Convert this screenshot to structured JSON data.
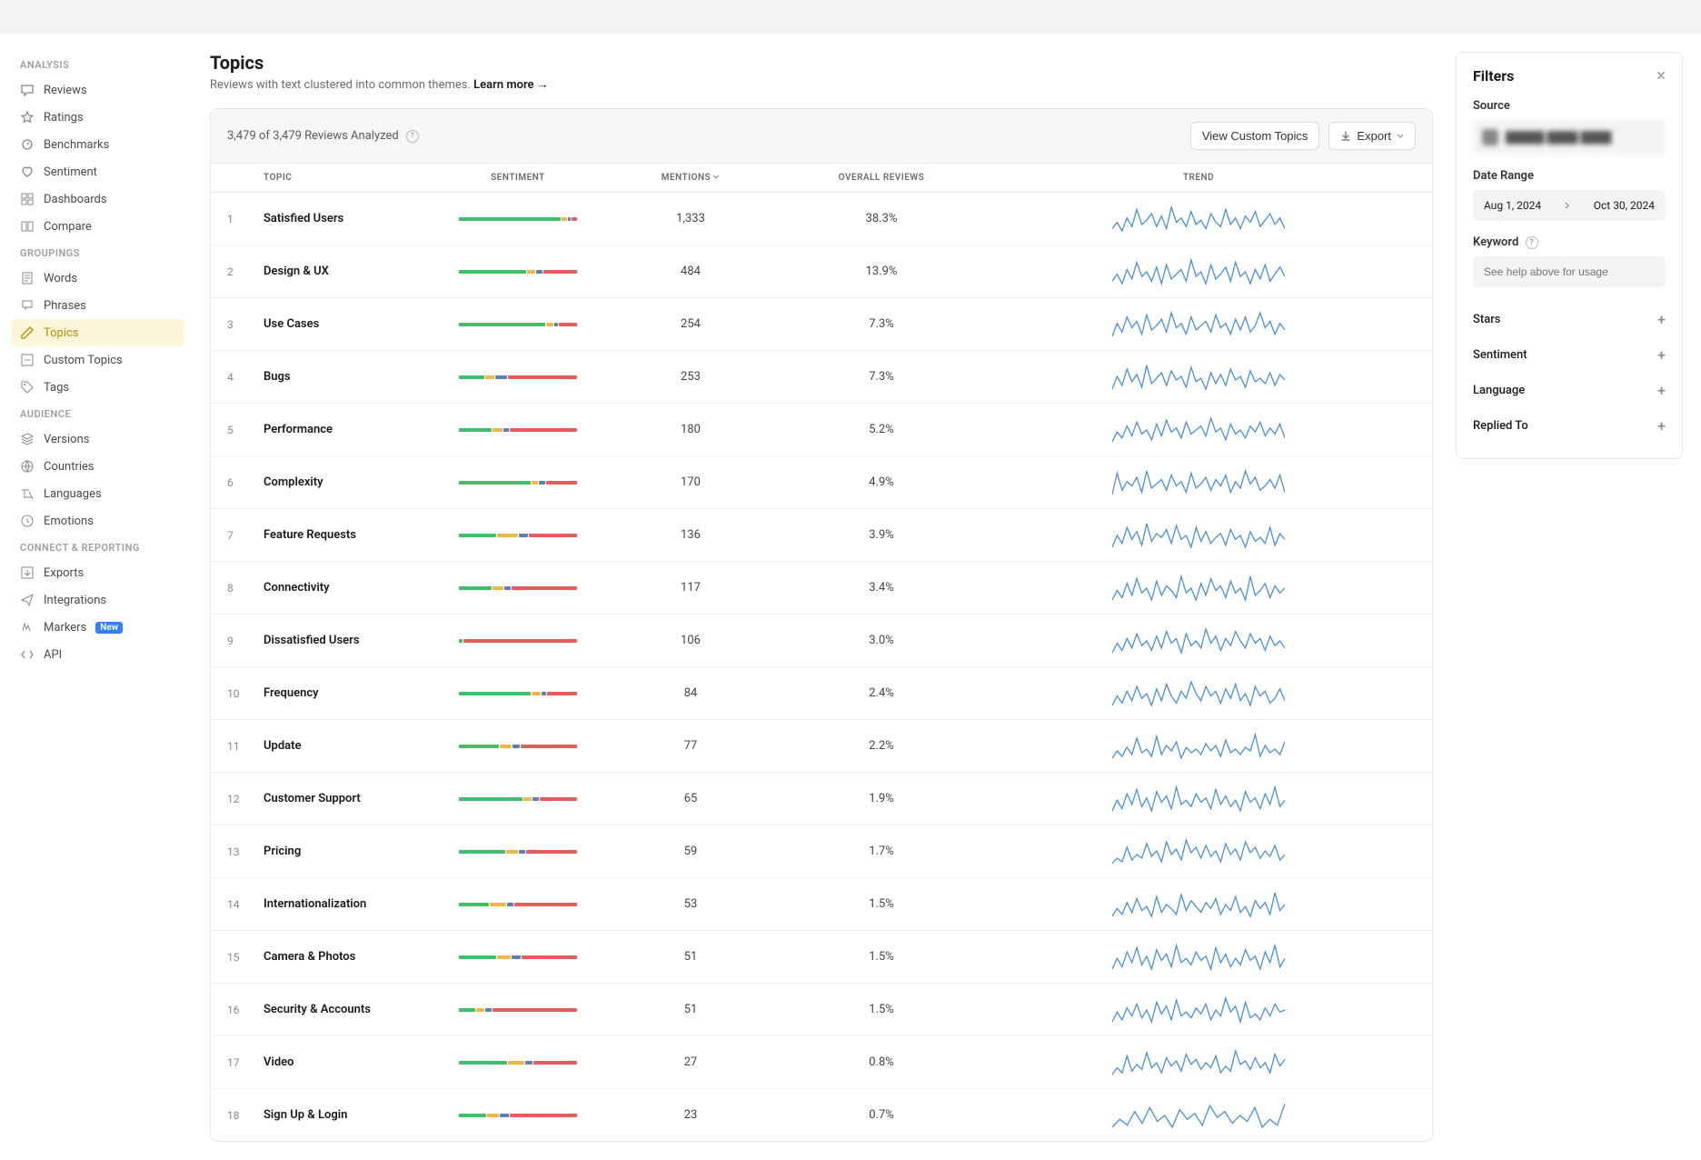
{
  "sidebar": {
    "sections": [
      {
        "heading": "ANALYSIS",
        "items": [
          {
            "label": "Reviews",
            "icon": "chat"
          },
          {
            "label": "Ratings",
            "icon": "star"
          },
          {
            "label": "Benchmarks",
            "icon": "speed"
          },
          {
            "label": "Sentiment",
            "icon": "heart"
          },
          {
            "label": "Dashboards",
            "icon": "grid"
          },
          {
            "label": "Compare",
            "icon": "compare"
          }
        ]
      },
      {
        "heading": "GROUPINGS",
        "items": [
          {
            "label": "Words",
            "icon": "doc"
          },
          {
            "label": "Phrases",
            "icon": "bubble"
          },
          {
            "label": "Topics",
            "icon": "pencil",
            "active": true
          },
          {
            "label": "Custom Topics",
            "icon": "edit"
          },
          {
            "label": "Tags",
            "icon": "tag"
          }
        ]
      },
      {
        "heading": "AUDIENCE",
        "items": [
          {
            "label": "Versions",
            "icon": "layers"
          },
          {
            "label": "Countries",
            "icon": "globe"
          },
          {
            "label": "Languages",
            "icon": "lang"
          },
          {
            "label": "Emotions",
            "icon": "clock"
          }
        ]
      },
      {
        "heading": "CONNECT & REPORTING",
        "items": [
          {
            "label": "Exports",
            "icon": "export"
          },
          {
            "label": "Integrations",
            "icon": "send"
          },
          {
            "label": "Markers",
            "icon": "marker",
            "badge": "New"
          },
          {
            "label": "API",
            "icon": "code"
          }
        ]
      }
    ]
  },
  "page": {
    "title": "Topics",
    "subtitle": "Reviews with text clustered into common themes.",
    "learn_more": "Learn more →"
  },
  "table": {
    "status": "3,479 of 3,479 Reviews Analyzed",
    "btn_custom": "View Custom Topics",
    "btn_export": "Export",
    "cols": {
      "topic": "TOPIC",
      "sentiment": "SENTIMENT",
      "mentions": "MENTIONS",
      "reviews": "OVERALL REVIEWS",
      "trend": "TREND"
    }
  },
  "chart_data": {
    "type": "table",
    "note": "Sentiment = stacked percentage bar [positive, warn, neutral, negative]. Trend = sparkline points.",
    "rows": [
      {
        "n": 1,
        "topic": "Satisfied Users",
        "mentions": "1,333",
        "reviews": "38.3%",
        "sent": [
          88,
          5,
          2,
          5
        ],
        "trend": [
          5,
          8,
          4,
          10,
          6,
          14,
          7,
          9,
          12,
          6,
          11,
          5,
          15,
          8,
          10,
          6,
          13,
          7,
          9,
          5,
          12,
          8,
          6,
          14,
          7,
          10,
          5,
          11,
          8,
          13,
          6,
          9,
          12,
          7,
          10,
          5
        ]
      },
      {
        "n": 2,
        "topic": "Design & UX",
        "mentions": "484",
        "reviews": "13.9%",
        "sent": [
          58,
          7,
          6,
          29
        ],
        "trend": [
          6,
          9,
          5,
          11,
          7,
          14,
          8,
          10,
          6,
          12,
          5,
          13,
          7,
          9,
          11,
          6,
          15,
          8,
          10,
          5,
          13,
          7,
          9,
          12,
          6,
          14,
          8,
          10,
          5,
          11,
          7,
          13,
          6,
          9,
          12,
          8
        ]
      },
      {
        "n": 3,
        "topic": "Use Cases",
        "mentions": "254",
        "reviews": "7.3%",
        "sent": [
          75,
          6,
          3,
          16
        ],
        "trend": [
          4,
          10,
          6,
          13,
          8,
          11,
          5,
          14,
          7,
          9,
          12,
          6,
          15,
          8,
          10,
          5,
          13,
          7,
          9,
          11,
          6,
          14,
          8,
          10,
          5,
          12,
          7,
          13,
          6,
          9,
          15,
          8,
          11,
          5,
          10,
          7
        ]
      },
      {
        "n": 4,
        "topic": "Bugs",
        "mentions": "253",
        "reviews": "7.3%",
        "sent": [
          22,
          8,
          10,
          60
        ],
        "trend": [
          5,
          12,
          7,
          16,
          9,
          13,
          6,
          18,
          8,
          11,
          14,
          7,
          15,
          10,
          12,
          6,
          17,
          9,
          11,
          5,
          14,
          8,
          13,
          7,
          16,
          10,
          12,
          6,
          15,
          9,
          11,
          8,
          14,
          7,
          13,
          10
        ]
      },
      {
        "n": 5,
        "topic": "Performance",
        "mentions": "180",
        "reviews": "5.2%",
        "sent": [
          28,
          9,
          5,
          58
        ],
        "trend": [
          3,
          8,
          5,
          11,
          6,
          13,
          7,
          9,
          4,
          12,
          6,
          14,
          8,
          10,
          5,
          13,
          7,
          9,
          11,
          6,
          15,
          8,
          10,
          4,
          12,
          7,
          9,
          5,
          11,
          8,
          13,
          6,
          10,
          7,
          12,
          5
        ]
      },
      {
        "n": 6,
        "topic": "Complexity",
        "mentions": "170",
        "reviews": "4.9%",
        "sent": [
          62,
          6,
          5,
          27
        ],
        "trend": [
          4,
          14,
          6,
          10,
          8,
          12,
          5,
          15,
          7,
          9,
          11,
          6,
          13,
          8,
          10,
          5,
          14,
          7,
          9,
          12,
          6,
          11,
          8,
          13,
          5,
          10,
          7,
          15,
          9,
          12,
          6,
          8,
          11,
          7,
          13,
          5
        ]
      },
      {
        "n": 7,
        "topic": "Feature Requests",
        "mentions": "136",
        "reviews": "3.9%",
        "sent": [
          32,
          18,
          8,
          42
        ],
        "trend": [
          6,
          12,
          8,
          16,
          10,
          14,
          7,
          18,
          9,
          13,
          11,
          15,
          8,
          17,
          10,
          12,
          6,
          16,
          9,
          14,
          8,
          11,
          13,
          7,
          15,
          10,
          12,
          6,
          14,
          9,
          11,
          8,
          16,
          7,
          13,
          10
        ]
      },
      {
        "n": 8,
        "topic": "Connectivity",
        "mentions": "117",
        "reviews": "3.4%",
        "sent": [
          28,
          10,
          5,
          57
        ],
        "trend": [
          5,
          9,
          6,
          12,
          7,
          14,
          8,
          10,
          5,
          13,
          7,
          11,
          9,
          6,
          15,
          8,
          10,
          5,
          12,
          7,
          14,
          9,
          11,
          6,
          13,
          8,
          10,
          5,
          15,
          7,
          9,
          12,
          6,
          11,
          8,
          10
        ]
      },
      {
        "n": 9,
        "topic": "Dissatisfied Users",
        "mentions": "106",
        "reviews": "3.0%",
        "sent": [
          3,
          0,
          0,
          97
        ],
        "trend": [
          3,
          7,
          4,
          9,
          5,
          11,
          6,
          8,
          4,
          10,
          5,
          12,
          7,
          9,
          3,
          11,
          6,
          8,
          5,
          13,
          7,
          10,
          4,
          9,
          6,
          12,
          8,
          5,
          11,
          7,
          9,
          4,
          10,
          6,
          8,
          5
        ]
      },
      {
        "n": 10,
        "topic": "Frequency",
        "mentions": "84",
        "reviews": "2.4%",
        "sent": [
          62,
          8,
          4,
          26
        ],
        "trend": [
          4,
          8,
          5,
          10,
          6,
          12,
          7,
          9,
          4,
          11,
          6,
          13,
          8,
          5,
          10,
          7,
          14,
          9,
          6,
          12,
          8,
          10,
          5,
          11,
          7,
          13,
          6,
          9,
          4,
          12,
          8,
          10,
          5,
          7,
          11,
          6
        ]
      },
      {
        "n": 11,
        "topic": "Update",
        "mentions": "77",
        "reviews": "2.2%",
        "sent": [
          35,
          10,
          6,
          49
        ],
        "trend": [
          3,
          7,
          4,
          9,
          5,
          14,
          6,
          8,
          4,
          15,
          5,
          10,
          7,
          12,
          3,
          9,
          6,
          8,
          5,
          11,
          7,
          10,
          4,
          13,
          6,
          8,
          5,
          9,
          7,
          16,
          4,
          10,
          6,
          8,
          5,
          12
        ]
      },
      {
        "n": 12,
        "topic": "Customer Support",
        "mentions": "65",
        "reviews": "1.9%",
        "sent": [
          55,
          7,
          6,
          32
        ],
        "trend": [
          4,
          9,
          5,
          12,
          7,
          14,
          6,
          10,
          4,
          13,
          8,
          11,
          5,
          15,
          7,
          9,
          6,
          12,
          8,
          10,
          5,
          14,
          7,
          11,
          6,
          9,
          4,
          13,
          8,
          10,
          5,
          12,
          7,
          15,
          6,
          9
        ]
      },
      {
        "n": 13,
        "topic": "Pricing",
        "mentions": "59",
        "reviews": "1.7%",
        "sent": [
          40,
          10,
          6,
          44
        ],
        "trend": [
          3,
          6,
          4,
          12,
          5,
          8,
          6,
          14,
          7,
          10,
          4,
          15,
          8,
          11,
          5,
          16,
          9,
          12,
          6,
          13,
          7,
          10,
          4,
          14,
          8,
          11,
          5,
          15,
          9,
          12,
          6,
          10,
          7,
          13,
          5,
          8
        ]
      },
      {
        "n": 14,
        "topic": "Internationalization",
        "mentions": "53",
        "reviews": "1.5%",
        "sent": [
          26,
          14,
          6,
          54
        ],
        "trend": [
          4,
          8,
          5,
          11,
          6,
          13,
          7,
          9,
          4,
          14,
          6,
          10,
          8,
          5,
          15,
          7,
          12,
          9,
          6,
          11,
          8,
          13,
          5,
          10,
          7,
          14,
          6,
          9,
          4,
          12,
          8,
          11,
          5,
          16,
          7,
          10
        ]
      },
      {
        "n": 15,
        "topic": "Camera & Photos",
        "mentions": "51",
        "reviews": "1.5%",
        "sent": [
          32,
          12,
          8,
          48
        ],
        "trend": [
          5,
          10,
          6,
          13,
          8,
          15,
          7,
          11,
          5,
          14,
          9,
          12,
          6,
          16,
          8,
          10,
          7,
          13,
          9,
          11,
          5,
          15,
          8,
          12,
          6,
          10,
          7,
          14,
          9,
          11,
          5,
          13,
          8,
          16,
          6,
          10
        ]
      },
      {
        "n": 16,
        "topic": "Security & Accounts",
        "mentions": "51",
        "reviews": "1.5%",
        "sent": [
          14,
          7,
          6,
          73
        ],
        "trend": [
          4,
          9,
          5,
          11,
          7,
          13,
          6,
          10,
          4,
          14,
          8,
          12,
          5,
          15,
          7,
          9,
          6,
          11,
          8,
          13,
          5,
          10,
          7,
          16,
          9,
          12,
          4,
          14,
          6,
          8,
          5,
          11,
          7,
          13,
          9,
          10
        ]
      },
      {
        "n": 17,
        "topic": "Video",
        "mentions": "27",
        "reviews": "0.8%",
        "sent": [
          42,
          14,
          6,
          38
        ],
        "trend": [
          3,
          7,
          4,
          14,
          5,
          9,
          6,
          16,
          7,
          10,
          4,
          13,
          8,
          11,
          5,
          15,
          9,
          12,
          6,
          10,
          7,
          14,
          4,
          8,
          5,
          17,
          9,
          11,
          6,
          13,
          7,
          10,
          4,
          15,
          8,
          12
        ]
      },
      {
        "n": 18,
        "topic": "Sign Up & Login",
        "mentions": "23",
        "reviews": "0.7%",
        "sent": [
          24,
          10,
          8,
          58
        ],
        "trend": [
          4,
          8,
          5,
          12,
          6,
          14,
          7,
          10,
          4,
          13,
          8,
          11,
          5,
          15,
          9,
          12,
          6,
          10,
          7,
          14,
          4,
          8,
          5,
          16
        ]
      }
    ]
  },
  "filters": {
    "title": "Filters",
    "source_label": "Source",
    "source_value": "█████ ████ ████",
    "date_label": "Date Range",
    "date_from": "Aug 1, 2024",
    "date_to": "Oct 30, 2024",
    "keyword_label": "Keyword",
    "keyword_placeholder": "See help above for usage",
    "rows": [
      {
        "label": "Stars"
      },
      {
        "label": "Sentiment"
      },
      {
        "label": "Language"
      },
      {
        "label": "Replied To"
      }
    ]
  }
}
